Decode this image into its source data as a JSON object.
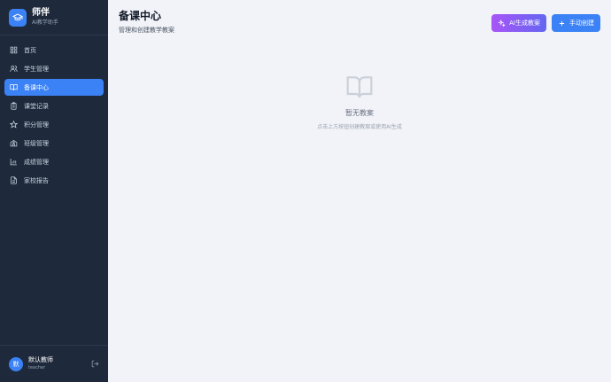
{
  "brand": {
    "name": "师伴",
    "subtitle": "AI教学助手"
  },
  "sidebar": {
    "items": [
      {
        "label": "首页",
        "icon": "dashboard-icon",
        "active": false
      },
      {
        "label": "学生管理",
        "icon": "users-icon",
        "active": false
      },
      {
        "label": "备课中心",
        "icon": "book-icon",
        "active": true
      },
      {
        "label": "课堂记录",
        "icon": "clipboard-icon",
        "active": false
      },
      {
        "label": "积分管理",
        "icon": "star-icon",
        "active": false
      },
      {
        "label": "班级管理",
        "icon": "school-icon",
        "active": false
      },
      {
        "label": "成绩管理",
        "icon": "bar-chart-icon",
        "active": false
      },
      {
        "label": "家校报告",
        "icon": "file-text-icon",
        "active": false
      }
    ]
  },
  "user": {
    "avatar_text": "默",
    "name": "默认教师",
    "role": "teacher"
  },
  "header": {
    "title": "备课中心",
    "subtitle": "管理和创建教学教案"
  },
  "actions": {
    "ai_label": "AI生成教案",
    "create_label": "手动创建"
  },
  "empty": {
    "title": "暂无教案",
    "hint": "点击上方按钮创建教案或使用AI生成"
  },
  "colors": {
    "accent": "#3b82f6",
    "sidebar_bg": "#1e293b",
    "ai_gradient_start": "#a855f7",
    "ai_gradient_end": "#6366f1"
  }
}
